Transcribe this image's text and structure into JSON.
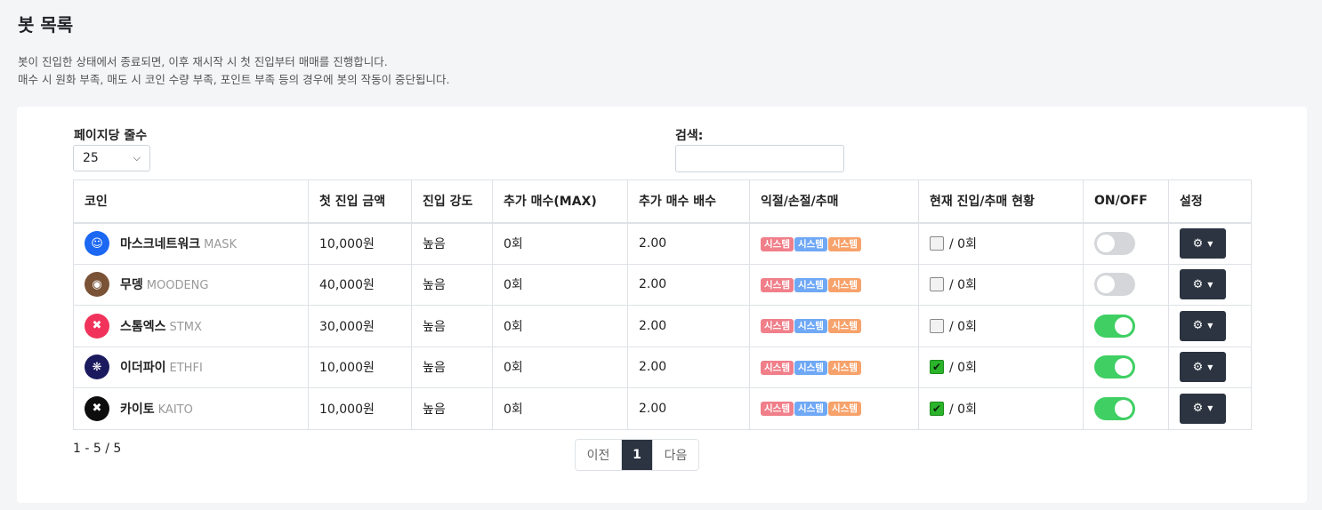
{
  "page": {
    "title": "봇 목록",
    "desc_line1": "봇이 진입한 상태에서 종료되면, 이후 재시작 시 첫 진입부터 매매를 진행합니다.",
    "desc_line2": "매수 시 원화 부족, 매도 시 코인 수량 부족, 포인트 부족 등의 경우에 봇의 작동이 중단됩니다."
  },
  "controls": {
    "length_label": "페이지당 줄수",
    "length_value": "25",
    "search_label": "검색:",
    "search_value": ""
  },
  "table": {
    "headers": [
      "코인",
      "첫 진입 금액",
      "진입 강도",
      "추가 매수(MAX)",
      "추가 매수 배수",
      "익절/손절/추매",
      "현재 진입/추매 현황",
      "ON/OFF",
      "설정"
    ],
    "rows": [
      {
        "name": "마스크네트워크",
        "symbol": "MASK",
        "logo_color": "#1c68f3",
        "amount": "10,000원",
        "strength": "높음",
        "max_add": "0회",
        "multiplier": "2.00",
        "tags": [
          "시스템",
          "시스템",
          "시스템"
        ],
        "entered": false,
        "status_text": "/ 0회",
        "on": false
      },
      {
        "name": "무뎅",
        "symbol": "MOODENG",
        "logo_color": "#7a5236",
        "amount": "40,000원",
        "strength": "높음",
        "max_add": "0회",
        "multiplier": "2.00",
        "tags": [
          "시스템",
          "시스템",
          "시스템"
        ],
        "entered": false,
        "status_text": "/ 0회",
        "on": false
      },
      {
        "name": "스톰엑스",
        "symbol": "STMX",
        "logo_color": "#f1325a",
        "amount": "30,000원",
        "strength": "높음",
        "max_add": "0회",
        "multiplier": "2.00",
        "tags": [
          "시스템",
          "시스템",
          "시스템"
        ],
        "entered": false,
        "status_text": "/ 0회",
        "on": true
      },
      {
        "name": "이더파이",
        "symbol": "ETHFI",
        "logo_color": "#1c1a5e",
        "amount": "10,000원",
        "strength": "높음",
        "max_add": "0회",
        "multiplier": "2.00",
        "tags": [
          "시스템",
          "시스템",
          "시스템"
        ],
        "entered": true,
        "status_text": "/ 0회",
        "on": true
      },
      {
        "name": "카이토",
        "symbol": "KAITO",
        "logo_color": "#0d0d0d",
        "amount": "10,000원",
        "strength": "높음",
        "max_add": "0회",
        "multiplier": "2.00",
        "tags": [
          "시스템",
          "시스템",
          "시스템"
        ],
        "entered": true,
        "status_text": "/ 0회",
        "on": true
      }
    ]
  },
  "tag_colors": [
    "#f07f8a",
    "#6fa8f5",
    "#f7a26b"
  ],
  "footer": {
    "info": "1 - 5 / 5",
    "prev": "이전",
    "current": "1",
    "next": "다음"
  }
}
